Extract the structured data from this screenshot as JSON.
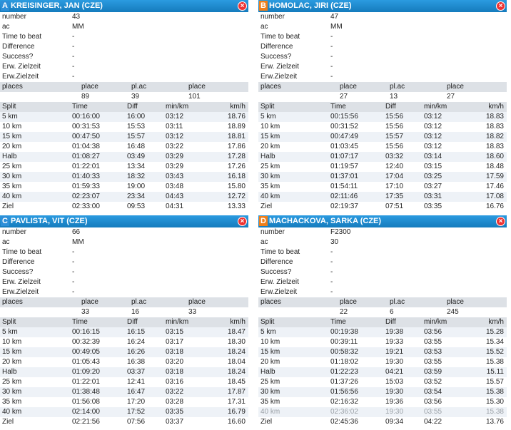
{
  "panels": [
    {
      "letter": "A",
      "badge_color": "#2e8fd8",
      "title": "KREISINGER, JAN (CZE)",
      "info": [
        {
          "label": "number",
          "value": "43"
        },
        {
          "label": "ac",
          "value": "MM"
        },
        {
          "label": "Time to beat",
          "value": "-"
        },
        {
          "label": "Difference",
          "value": "-"
        },
        {
          "label": "Success?",
          "value": "-"
        },
        {
          "label": "Erw. Zielzeit",
          "value": "-"
        },
        {
          "label": "Erw.Zielzeit",
          "value": "-"
        }
      ],
      "places_label": "places",
      "places_headers": [
        "place",
        "pl.ac",
        "place"
      ],
      "places_values": [
        "89",
        "39",
        "101"
      ],
      "split_headers": [
        "Split",
        "Time",
        "Diff",
        "min/km",
        "km/h"
      ],
      "splits": [
        [
          "5 km",
          "00:16:00",
          "16:00",
          "03:12",
          "18.76"
        ],
        [
          "10 km",
          "00:31:53",
          "15:53",
          "03:11",
          "18.89"
        ],
        [
          "15 km",
          "00:47:50",
          "15:57",
          "03:12",
          "18.81"
        ],
        [
          "20 km",
          "01:04:38",
          "16:48",
          "03:22",
          "17.86"
        ],
        [
          "Halb",
          "01:08:27",
          "03:49",
          "03:29",
          "17.28"
        ],
        [
          "25 km",
          "01:22:01",
          "13:34",
          "03:29",
          "17.26"
        ],
        [
          "30 km",
          "01:40:33",
          "18:32",
          "03:43",
          "16.18"
        ],
        [
          "35 km",
          "01:59:33",
          "19:00",
          "03:48",
          "15.80"
        ],
        [
          "40 km",
          "02:23:07",
          "23:34",
          "04:43",
          "12.72"
        ],
        [
          "Ziel",
          "02:33:00",
          "09:53",
          "04:31",
          "13.33"
        ]
      ]
    },
    {
      "letter": "B",
      "badge_color": "#f07f1a",
      "title": "HOMOLAC, JIRI (CZE)",
      "info": [
        {
          "label": "number",
          "value": "47"
        },
        {
          "label": "ac",
          "value": "MM"
        },
        {
          "label": "Time to beat",
          "value": "-"
        },
        {
          "label": "Difference",
          "value": "-"
        },
        {
          "label": "Success?",
          "value": "-"
        },
        {
          "label": "Erw. Zielzeit",
          "value": "-"
        },
        {
          "label": "Erw.Zielzeit",
          "value": "-"
        }
      ],
      "places_label": "places",
      "places_headers": [
        "place",
        "pl.ac",
        "place"
      ],
      "places_values": [
        "27",
        "13",
        "27"
      ],
      "split_headers": [
        "Split",
        "Time",
        "Diff",
        "min/km",
        "km/h"
      ],
      "splits": [
        [
          "5 km",
          "00:15:56",
          "15:56",
          "03:12",
          "18.83"
        ],
        [
          "10 km",
          "00:31:52",
          "15:56",
          "03:12",
          "18.83"
        ],
        [
          "15 km",
          "00:47:49",
          "15:57",
          "03:12",
          "18.82"
        ],
        [
          "20 km",
          "01:03:45",
          "15:56",
          "03:12",
          "18.83"
        ],
        [
          "Halb",
          "01:07:17",
          "03:32",
          "03:14",
          "18.60"
        ],
        [
          "25 km",
          "01:19:57",
          "12:40",
          "03:15",
          "18.48"
        ],
        [
          "30 km",
          "01:37:01",
          "17:04",
          "03:25",
          "17.59"
        ],
        [
          "35 km",
          "01:54:11",
          "17:10",
          "03:27",
          "17.46"
        ],
        [
          "40 km",
          "02:11:46",
          "17:35",
          "03:31",
          "17.08"
        ],
        [
          "Ziel",
          "02:19:37",
          "07:51",
          "03:35",
          "16.76"
        ]
      ]
    },
    {
      "letter": "C",
      "badge_color": "#2e8fd8",
      "title": "PAVLISTA, VIT (CZE)",
      "info": [
        {
          "label": "number",
          "value": "66"
        },
        {
          "label": "ac",
          "value": "MM"
        },
        {
          "label": "Time to beat",
          "value": "-"
        },
        {
          "label": "Difference",
          "value": "-"
        },
        {
          "label": "Success?",
          "value": "-"
        },
        {
          "label": "Erw. Zielzeit",
          "value": "-"
        },
        {
          "label": "Erw.Zielzeit",
          "value": "-"
        }
      ],
      "places_label": "places",
      "places_headers": [
        "place",
        "pl.ac",
        "place"
      ],
      "places_values": [
        "33",
        "16",
        "33"
      ],
      "split_headers": [
        "Split",
        "Time",
        "Diff",
        "min/km",
        "km/h"
      ],
      "splits": [
        [
          "5 km",
          "00:16:15",
          "16:15",
          "03:15",
          "18.47"
        ],
        [
          "10 km",
          "00:32:39",
          "16:24",
          "03:17",
          "18.30"
        ],
        [
          "15 km",
          "00:49:05",
          "16:26",
          "03:18",
          "18.24"
        ],
        [
          "20 km",
          "01:05:43",
          "16:38",
          "03:20",
          "18.04"
        ],
        [
          "Halb",
          "01:09:20",
          "03:37",
          "03:18",
          "18.24"
        ],
        [
          "25 km",
          "01:22:01",
          "12:41",
          "03:16",
          "18.45"
        ],
        [
          "30 km",
          "01:38:48",
          "16:47",
          "03:22",
          "17.87"
        ],
        [
          "35 km",
          "01:56:08",
          "17:20",
          "03:28",
          "17.31"
        ],
        [
          "40 km",
          "02:14:00",
          "17:52",
          "03:35",
          "16.79"
        ],
        [
          "Ziel",
          "02:21:56",
          "07:56",
          "03:37",
          "16.60"
        ]
      ]
    },
    {
      "letter": "D",
      "badge_color": "#f07f1a",
      "title": "MACHACKOVA, SARKA (CZE)",
      "info": [
        {
          "label": "number",
          "value": "F2300"
        },
        {
          "label": "ac",
          "value": "30"
        },
        {
          "label": "Time to beat",
          "value": "-"
        },
        {
          "label": "Difference",
          "value": "-"
        },
        {
          "label": "Success?",
          "value": "-"
        },
        {
          "label": "Erw. Zielzeit",
          "value": "-"
        },
        {
          "label": "Erw.Zielzeit",
          "value": "-"
        }
      ],
      "places_label": "places",
      "places_headers": [
        "place",
        "pl.ac",
        "place"
      ],
      "places_values": [
        "22",
        "6",
        "245"
      ],
      "split_headers": [
        "Split",
        "Time",
        "Diff",
        "min/km",
        "km/h"
      ],
      "splits": [
        [
          "5 km",
          "00:19:38",
          "19:38",
          "03:56",
          "15.28"
        ],
        [
          "10 km",
          "00:39:11",
          "19:33",
          "03:55",
          "15.34"
        ],
        [
          "15 km",
          "00:58:32",
          "19:21",
          "03:53",
          "15.52"
        ],
        [
          "20 km",
          "01:18:02",
          "19:30",
          "03:55",
          "15.38"
        ],
        [
          "Halb",
          "01:22:23",
          "04:21",
          "03:59",
          "15.11"
        ],
        [
          "25 km",
          "01:37:26",
          "15:03",
          "03:52",
          "15.57"
        ],
        [
          "30 km",
          "01:56:56",
          "19:30",
          "03:54",
          "15.38"
        ],
        [
          "35 km",
          "02:16:32",
          "19:36",
          "03:56",
          "15.30"
        ],
        [
          "40 km",
          "02:36:02",
          "19:30",
          "03:55",
          "15.38"
        ],
        [
          "Ziel",
          "02:45:36",
          "09:34",
          "04:22",
          "13.76"
        ]
      ],
      "dim_rows": [
        8
      ]
    }
  ]
}
